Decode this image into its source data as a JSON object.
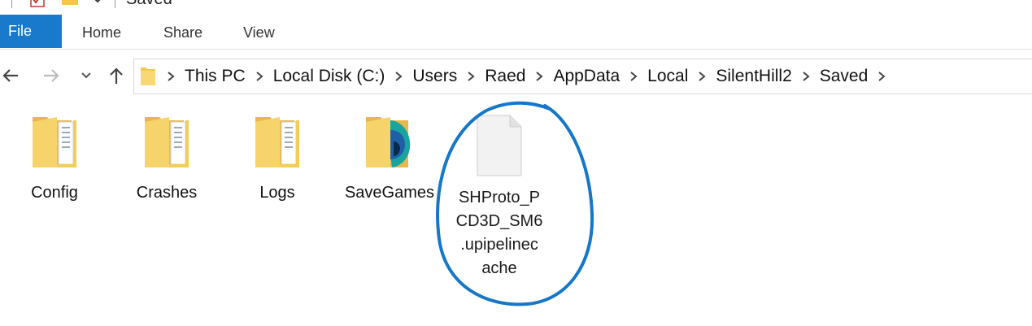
{
  "window": {
    "title": "Saved"
  },
  "ribbon": {
    "file": "File",
    "tabs": [
      "Home",
      "Share",
      "View"
    ]
  },
  "nav": {
    "back": "back-arrow-icon",
    "forward": "forward-arrow-icon",
    "recent": "chevron-down-icon",
    "up": "up-arrow-icon"
  },
  "breadcrumb": [
    "This PC",
    "Local Disk (C:)",
    "Users",
    "Raed",
    "AppData",
    "Local",
    "SilentHill2",
    "Saved"
  ],
  "items": [
    {
      "name": "Config",
      "type": "folder"
    },
    {
      "name": "Crashes",
      "type": "folder"
    },
    {
      "name": "Logs",
      "type": "folder"
    },
    {
      "name": "SaveGames",
      "type": "folder-app"
    }
  ],
  "file": {
    "name_lines": [
      "SHProto_P",
      "CD3D_SM6",
      ".upipelinec",
      "ache"
    ],
    "annotation": "blue-hand-drawn-circle"
  },
  "colors": {
    "file_tab": "#1979ca",
    "folder": "#f6d46b",
    "annotation": "#1677c8"
  }
}
